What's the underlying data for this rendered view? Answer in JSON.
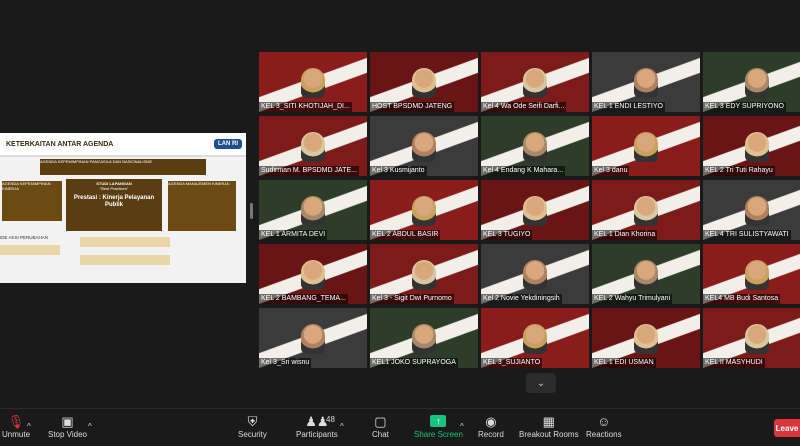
{
  "shared_screen": {
    "title": "KETERKAITAN ANTAR AGENDA",
    "logo": "LAN RI",
    "top_box": "AGENDA KEPEMIMPINAN PANCASILA DAN NASIONALISME",
    "left_box": "AGENDA KEPEMIMPINAN KINERJA",
    "mid_box_title": "STUDI LAPANGAN",
    "mid_box_sub": "\"Best Practices\"",
    "mid_box_big": "Prestasi : Kinerja Pelayanan Publik",
    "right_box": "AGENDA MANAJEMEN KINERJA",
    "bottom_label": "IDE AKSI PERUBAHAN"
  },
  "participants": [
    {
      "name": "KEL 3_SITI KHOTIJAH_DI..."
    },
    {
      "name": "HOST BPSDMD JATENG"
    },
    {
      "name": "Kel 4 Wa Ode Seifi Darfi..."
    },
    {
      "name": "KEL 1 ENDI LESTIYO"
    },
    {
      "name": "KEL 3 EDY SUPRIYONO"
    },
    {
      "name": "Sudirman M. BPSDMD JATE..."
    },
    {
      "name": "Kel 3 Kusmijanto"
    },
    {
      "name": "Kel 4 Endang K Mahara..."
    },
    {
      "name": "Kel 3 danu"
    },
    {
      "name": "KEL 2 Tri Tuti Rahayu"
    },
    {
      "name": "KEL 1 ARMITA DEVI"
    },
    {
      "name": "KEL 2 ABDUL BASIR"
    },
    {
      "name": "KEL 3 TUGIYO"
    },
    {
      "name": "KEL 1 Dian Khorina"
    },
    {
      "name": "KEL 4 TRI SULISTYAWATI"
    },
    {
      "name": "KEL 2 BAMBANG_TEMA..."
    },
    {
      "name": "Kel 3 - Sigit Dwi Purnomo"
    },
    {
      "name": "Kel 2 Novie Yekdiningsih"
    },
    {
      "name": "KEL 2 Wahyu Trimulyani"
    },
    {
      "name": "KEL4 MB Budi Santosa"
    },
    {
      "name": "Kel 3_Sri wisnu"
    },
    {
      "name": "KEL1 JOKO SUPRAYOGA"
    },
    {
      "name": "KEL 3_SUJIANTO"
    },
    {
      "name": "KEL 1 EDI USMAN"
    },
    {
      "name": "KEL II MASYHUDI"
    }
  ],
  "toolbar": {
    "unmute": "Unmute",
    "stop_video": "Stop Video",
    "security": "Security",
    "participants": "Participants",
    "participants_count": "48",
    "chat": "Chat",
    "share_screen": "Share Screen",
    "record": "Record",
    "breakout": "Breakout Rooms",
    "reactions": "Reactions",
    "leave": "Leave"
  },
  "icons": {
    "mic": "mic-off-icon",
    "video": "video-camera-icon",
    "security": "shield-icon",
    "participants": "people-icon",
    "chat": "chat-bubble-icon",
    "share": "share-screen-icon",
    "record": "record-icon",
    "breakout": "breakout-rooms-icon",
    "reactions": "smiley-icon"
  },
  "colors": {
    "share_green": "#19c37d",
    "leave_red": "#d9363e",
    "active_speaker": "#c7e21f",
    "banner_red": "#8a1c1c"
  }
}
